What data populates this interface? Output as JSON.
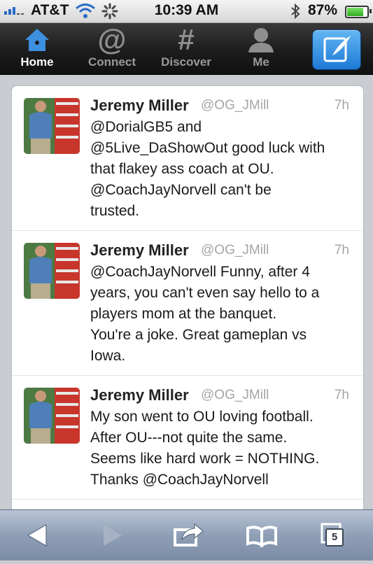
{
  "status_bar": {
    "carrier": "AT&T",
    "time": "10:39 AM",
    "battery": "87%",
    "battery_level": 0.87
  },
  "nav": {
    "items": [
      {
        "label": "Home",
        "icon": "home-icon",
        "active": true
      },
      {
        "label": "Connect",
        "icon": "at-icon",
        "active": false
      },
      {
        "label": "Discover",
        "icon": "hash-icon",
        "active": false
      },
      {
        "label": "Me",
        "icon": "person-icon",
        "active": false
      }
    ],
    "compose_icon": "compose-icon"
  },
  "tweets": [
    {
      "name": "Jeremy Miller",
      "handle": "@OG_JMill",
      "time": "7h",
      "text": "@DorialGB5 and\n@5Live_DaShowOut good luck with\nthat flakey ass coach at OU.\n@CoachJayNorvell can't be\ntrusted."
    },
    {
      "name": "Jeremy Miller",
      "handle": "@OG_JMill",
      "time": "7h",
      "text": "@CoachJayNorvell Funny, after 4\nyears, you can't even say hello to a\nplayers mom at the banquet.\nYou're a joke. Great gameplan vs\nIowa."
    },
    {
      "name": "Jeremy Miller",
      "handle": "@OG_JMill",
      "time": "7h",
      "text": "My son went to OU loving football.\nAfter OU---not quite the same.\nSeems like hard work = NOTHING.\nThanks @CoachJayNorvell"
    }
  ],
  "toolbar": {
    "tab_count": "5",
    "icons": [
      "back-arrow-icon",
      "forward-arrow-icon",
      "share-icon",
      "bookmarks-icon",
      "tabs-icon"
    ]
  },
  "colors": {
    "nav_background": "#1c1c1c",
    "compose_accent": "#1d7ad6",
    "toolbar_background": "#8f9fb6"
  }
}
